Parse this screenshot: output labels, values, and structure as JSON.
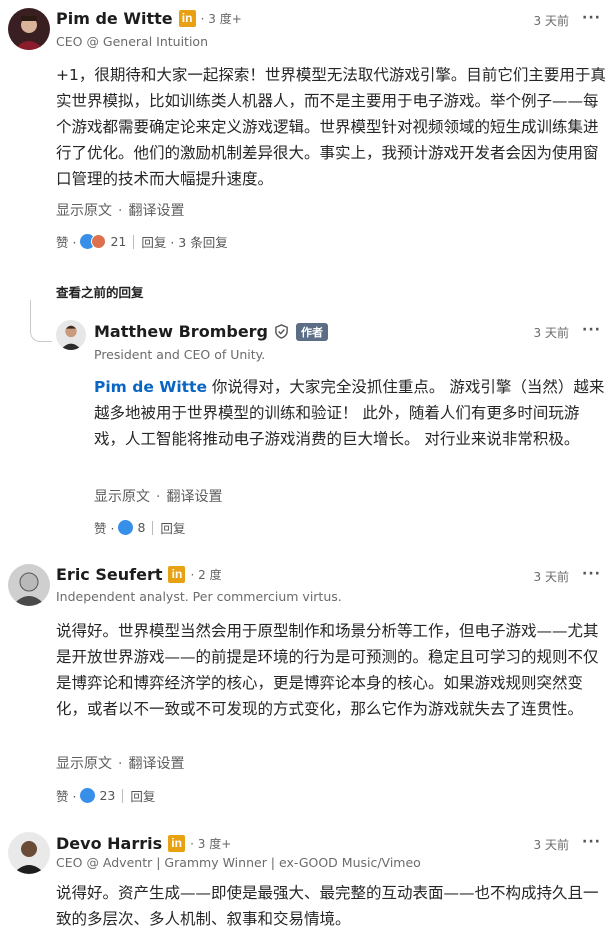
{
  "colors": {
    "accent": "#0a66c2",
    "badge": "#e8a113",
    "like": "#378fe9",
    "love": "#df704d",
    "author_tag": "#5b6e86"
  },
  "comments": [
    {
      "name": "Pim de Witte",
      "degree": "· 3 度+",
      "subtitle": "CEO @ General Intuition",
      "time": "3 天前",
      "more": "···",
      "body": "+1，很期待和大家一起探索！世界模型无法取代游戏引擎。目前它们主要用于真实世界模拟，比如训练类人机器人，而不是主要用于电子游戏。举个例子——每个游戏都需要确定论来定义游戏逻辑。世界模型针对视频领域的短生成训练集进行了优化。他们的激励机制差异很大。事实上，我预计游戏开发者会因为使用窗口管理的技术而大幅提升速度。",
      "show_original": "显示原文",
      "translate": "翻译设置",
      "like_label": "赞 ·",
      "count": "21",
      "reply": "回复 · 3 条回复",
      "icons": [
        "li-badge-icon",
        "like-reaction-icon",
        "love-reaction-icon"
      ]
    },
    {
      "view_previous": "查看之前的回复",
      "name": "Matthew Bromberg",
      "author_tag": "作者",
      "subtitle": "President and CEO of Unity.",
      "time": "3 天前",
      "more": "···",
      "mention": "Pim de Witte",
      "body": " 你说得对，大家完全没抓住重点。 游戏引擎（当然）越来越多地被用于世界模型的训练和验证！ 此外，随着人们有更多时间玩游戏，人工智能将推动电子游戏消费的巨大增长。 对行业来说非常积极。",
      "show_original": "显示原文",
      "translate": "翻译设置",
      "like_label": "赞 ·",
      "count": "8",
      "reply": "回复"
    },
    {
      "name": "Eric Seufert",
      "degree": "· 2 度",
      "subtitle": "Independent analyst. Per commercium virtus.",
      "time": "3 天前",
      "more": "···",
      "body": "说得好。世界模型当然会用于原型制作和场景分析等工作，但电子游戏——尤其是开放世界游戏——的前提是环境的行为是可预测的。稳定且可学习的规则不仅是博弈论和博弈经济学的核心，更是博弈论本身的核心。如果游戏规则突然变化，或者以不一致或不可发现的方式变化，那么它作为游戏就失去了连贯性。",
      "show_original": "显示原文",
      "translate": "翻译设置",
      "like_label": "赞 ·",
      "count": "23",
      "reply": "回复"
    },
    {
      "name": "Devo Harris",
      "degree": "· 3 度+",
      "subtitle": "CEO @ Adventr | Grammy Winner | ex-GOOD Music/Vimeo",
      "time": "3 天前",
      "more": "···",
      "body": "说得好。资产生成——即使是最强大、最完整的互动表面——也不构成持久且一致的多层次、多人机制、叙事和交易情境。"
    }
  ]
}
